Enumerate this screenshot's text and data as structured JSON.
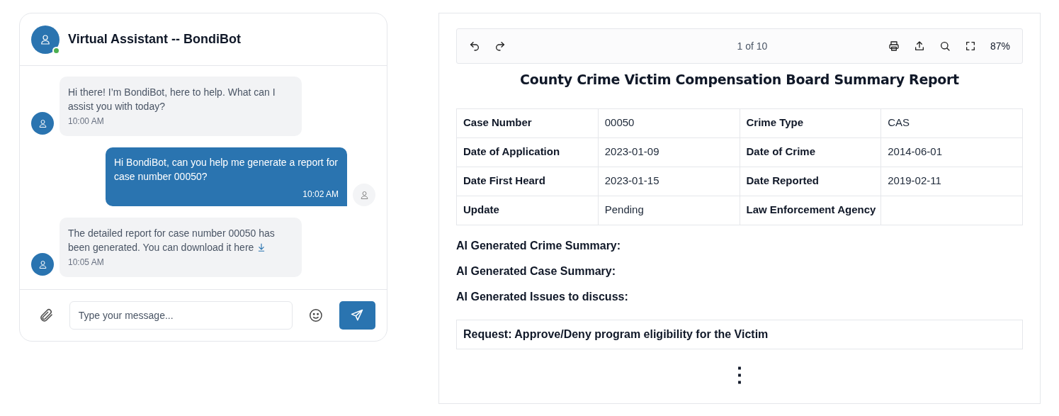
{
  "chat": {
    "title": "Virtual Assistant -- BondiBot",
    "online": true,
    "messages": [
      {
        "kind": "bot",
        "text": "Hi there! I’m BondiBot, here to help. What can I assist you with today?",
        "time": "10:00 AM",
        "download_link": false
      },
      {
        "kind": "user",
        "text": "Hi BondiBot, can you help me generate a report for case number 00050?",
        "time": "10:02 AM",
        "download_link": false
      },
      {
        "kind": "bot",
        "text": "The detailed report for case number 00050 has been generated. You can download it here",
        "time": "10:05 AM",
        "download_link": true
      }
    ],
    "input": {
      "placeholder": "Type your message..."
    }
  },
  "viewer": {
    "toolbar": {
      "page": "1 of 10",
      "zoom": "87%"
    },
    "report": {
      "title": "County Crime Victim Compensation Board Summary Report",
      "rows": [
        [
          {
            "label": "Case Number",
            "value": "00050"
          },
          {
            "label": "Crime Type",
            "value": "CAS"
          }
        ],
        [
          {
            "label": "Date of Application",
            "value": "2023-01-09"
          },
          {
            "label": "Date of Crime",
            "value": "2014-06-01"
          }
        ],
        [
          {
            "label": "Date First Heard",
            "value": "2023-01-15"
          },
          {
            "label": "Date Reported",
            "value": "2019-02-11"
          }
        ],
        [
          {
            "label": "Update",
            "value": "Pending"
          },
          {
            "label": "Law Enforcement Agency"
          }
        ]
      ],
      "sections": [
        "AI Generated Crime Summary:",
        "AI Generated Case Summary:",
        "AI Generated Issues to discuss:"
      ],
      "request": "Request: Approve/Deny program eligibility for the Victim",
      "more_indicator": "⋮"
    }
  }
}
